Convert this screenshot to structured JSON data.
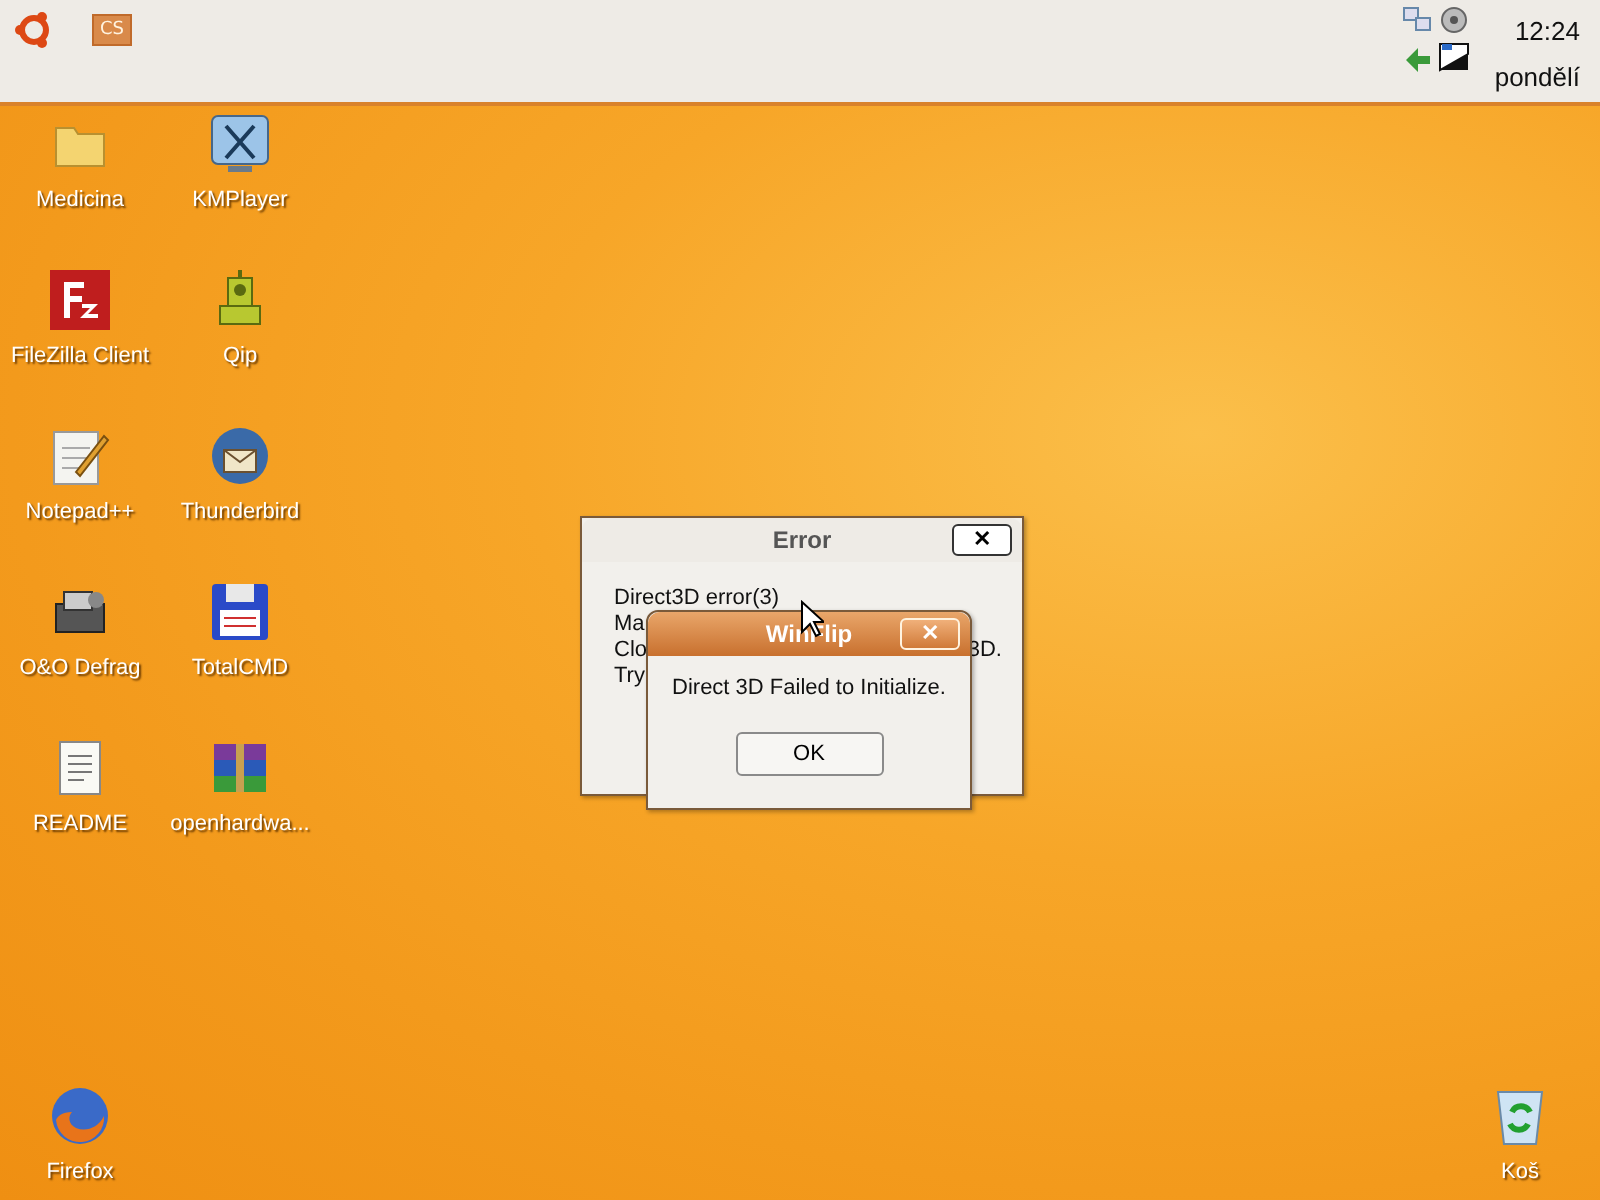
{
  "top_panel": {
    "launchers": [
      {
        "kind": "ubuntu"
      },
      {
        "kind": "cs",
        "label": "CS"
      }
    ],
    "clock": {
      "time": "12:24",
      "day": "pondělí"
    }
  },
  "desktop": {
    "icons": [
      {
        "kind": "folder",
        "label": "Medicina"
      },
      {
        "kind": "media-player",
        "label": "KMPlayer"
      },
      {
        "kind": "ftp",
        "label": "FileZilla Client"
      },
      {
        "kind": "chat",
        "label": "Qip"
      },
      {
        "kind": "notepad",
        "label": "Notepad++"
      },
      {
        "kind": "mail",
        "label": "Thunderbird"
      },
      {
        "kind": "defrag",
        "label": "O&O Defrag"
      },
      {
        "kind": "floppy",
        "label": "TotalCMD"
      },
      {
        "kind": "document",
        "label": "README"
      },
      {
        "kind": "archive",
        "label": "openhardwa..."
      }
    ],
    "bottom_icons": [
      {
        "kind": "browser",
        "label": "Firefox"
      },
      {
        "kind": "recycle-bin",
        "label": "Koš"
      }
    ]
  },
  "error_dialog": {
    "title": "Error",
    "close": "✕",
    "lines": [
      "Direct3D error(3)",
      "Ma",
      "Clo",
      "Try"
    ],
    "line_tail": "3D."
  },
  "winflip_dialog": {
    "title": "WinFlip",
    "close": "✕",
    "message": "Direct 3D Failed to Initialize.",
    "button": "OK"
  }
}
